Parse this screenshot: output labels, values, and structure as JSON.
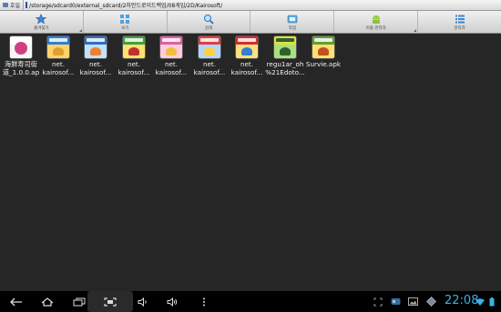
{
  "pathbar": {
    "home_label": "호일",
    "path": "/storage/sdcard0/external_sdcard/2차안드로이드백업/08게임/2D/Kairosoft/"
  },
  "toolbar": {
    "buttons": [
      {
        "label": "즐겨찾기",
        "icon": "star-icon"
      },
      {
        "label": "보기",
        "icon": "view-icon"
      },
      {
        "label": "검색",
        "icon": "search-icon"
      },
      {
        "label": "작업",
        "icon": "task-icon"
      },
      {
        "label": "어플 관리자",
        "icon": "android-icon"
      },
      {
        "label": "관리자",
        "icon": "list-icon"
      }
    ]
  },
  "files": [
    {
      "name": "海鮮寿司街\n道_1.0.0.ap",
      "colors": [
        "#f6f6f6",
        "#d04080",
        "#222222"
      ]
    },
    {
      "name": "net.\nkairosof...",
      "colors": [
        "#ffd36a",
        "#2f7fd0",
        "#e0a030"
      ]
    },
    {
      "name": "net.\nkairosof...",
      "colors": [
        "#bfe3ff",
        "#3070c0",
        "#f08030"
      ]
    },
    {
      "name": "net.\nkairosof...",
      "colors": [
        "#ffe070",
        "#40a040",
        "#c03030"
      ]
    },
    {
      "name": "net.\nkairosof...",
      "colors": [
        "#ffcce0",
        "#e060a0",
        "#f0c040"
      ]
    },
    {
      "name": "net.\nkairosof...",
      "colors": [
        "#b0d8ff",
        "#e04040",
        "#ffd040"
      ]
    },
    {
      "name": "net.\nkairosof...",
      "colors": [
        "#ffe080",
        "#d03030",
        "#3080d0"
      ]
    },
    {
      "name": "regu1ar_oh\n%21Edoto...",
      "colors": [
        "#a8e080",
        "#e0e040",
        "#306030"
      ]
    },
    {
      "name": "Survie.apk",
      "colors": [
        "#ffe070",
        "#60a030",
        "#c05020"
      ]
    }
  ],
  "statusbar": {
    "time": "22:08"
  }
}
